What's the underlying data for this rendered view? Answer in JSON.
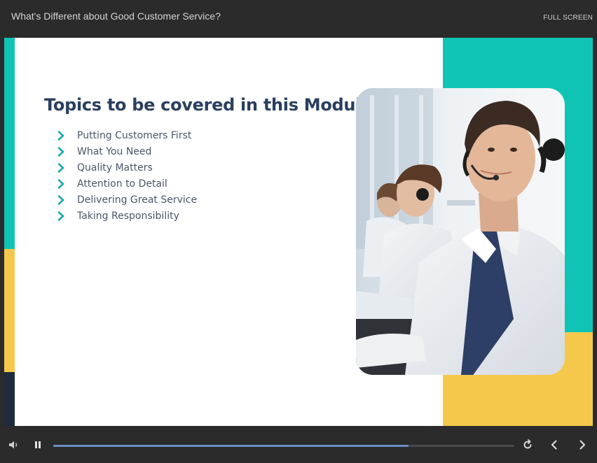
{
  "header": {
    "course_title": "What's Different about Good Customer Service?",
    "fullscreen_label": "FULL SCREEN"
  },
  "slide": {
    "heading": "Topics to be covered in this Module",
    "topics": [
      "Putting Customers First",
      "What You Need",
      "Quality Matters",
      "Attention to Detail",
      "Delivering Great Service",
      "Taking Responsibility"
    ],
    "photo": "call-center-agents-with-headsets",
    "colors": {
      "teal": "#0fc4b5",
      "yellow": "#f5c84c",
      "navy": "#1e2a3d",
      "heading": "#2a3f5f",
      "chevron": "#1aa7b8"
    }
  },
  "player": {
    "progress": 0.77,
    "icons": [
      "volume-icon",
      "pause-icon",
      "replay-icon",
      "previous-icon",
      "next-icon"
    ]
  }
}
